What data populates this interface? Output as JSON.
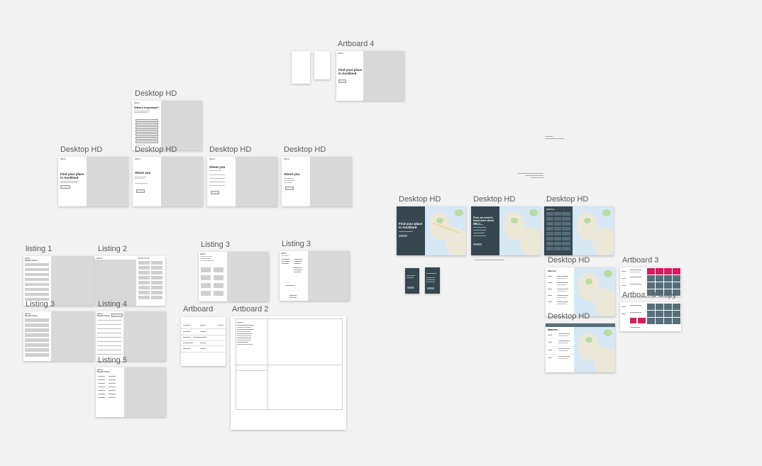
{
  "labels": {
    "artboard4": "Artboard 4",
    "desktop_hd_top": "Desktop HD",
    "desktop_hd_1": "Desktop HD",
    "desktop_hd_2": "Desktop HD",
    "desktop_hd_3": "Desktop HD",
    "desktop_hd_4": "Desktop HD",
    "desktop_hd_map1": "Desktop HD",
    "desktop_hd_map2": "Desktop HD",
    "desktop_hd_map3": "Desktop HD",
    "desktop_hd_map4": "Desktop HD",
    "desktop_hd_map5": "Desktop HD",
    "listing1": "listing 1",
    "listing2": "Listing 2",
    "listing3a": "Listing 3",
    "listing3b": "Listing 3",
    "listing3c": "Listing 3",
    "listing4": "Listing 4",
    "listing5": "Listing 5",
    "artboard": "Artboard",
    "artboard2": "Artboard 2",
    "artboard3": "Artboard 3",
    "artboard3copy": "Artboa...3 Copy"
  },
  "content": {
    "find_place": "Find your place in Auckland",
    "whats_important": "What's important?",
    "about_you": "About you",
    "first_tell": "First, we need to know more about you :)",
    "matches": "Matches"
  },
  "colors": {
    "canvas": "#f2f2f2",
    "dark_panel": "#37474f",
    "accent_pink": "#d81b60",
    "cell_slate": "#546e7a"
  }
}
